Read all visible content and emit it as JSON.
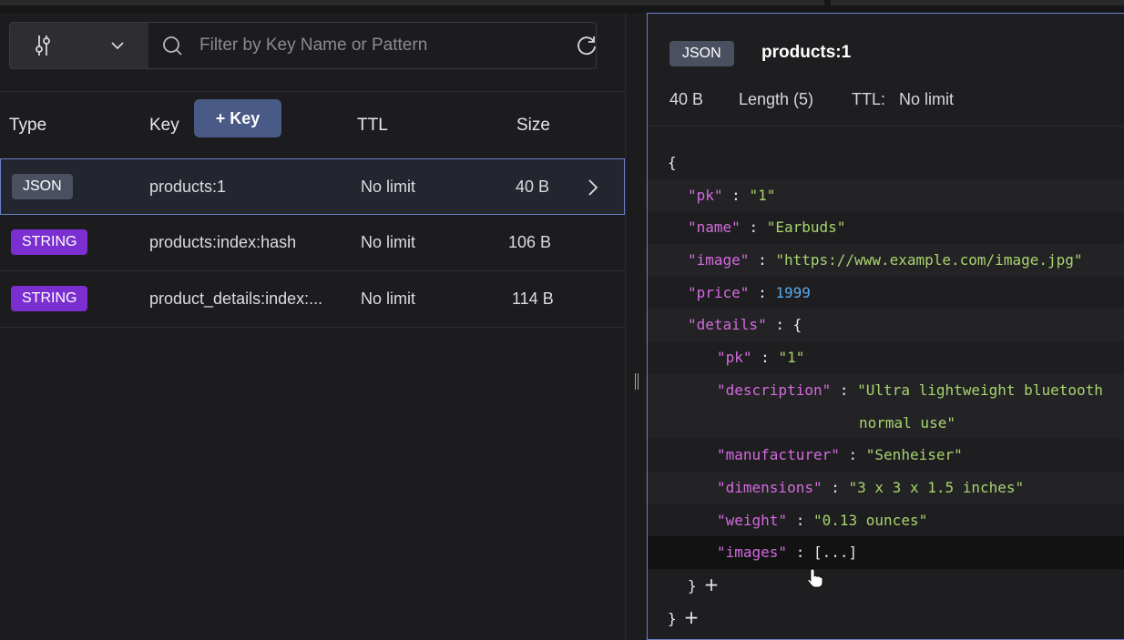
{
  "search": {
    "placeholder": "Filter by Key Name or Pattern"
  },
  "table": {
    "headers": {
      "type": "Type",
      "key": "Key",
      "add_key": "+ Key",
      "ttl": "TTL",
      "size": "Size"
    },
    "rows": [
      {
        "type": "JSON",
        "key": "products:1",
        "ttl": "No limit",
        "size": "40 B"
      },
      {
        "type": "STRING",
        "key": "products:index:hash",
        "ttl": "No limit",
        "size": "106 B"
      },
      {
        "type": "STRING",
        "key": "product_details:index:...",
        "ttl": "No limit",
        "size": "114 B"
      }
    ]
  },
  "detail": {
    "type": "JSON",
    "key": "products:1",
    "size": "40 B",
    "length": "Length (5)",
    "ttl_label": "TTL:",
    "ttl_value": "No limit",
    "json": {
      "open_brace": "{",
      "pk_key": "\"pk\"",
      "pk_val": "\"1\"",
      "name_key": "\"name\"",
      "name_val": "\"Earbuds\"",
      "image_key": "\"image\"",
      "image_val": "\"https://www.example.com/image.jpg\"",
      "price_key": "\"price\"",
      "price_val": "1999",
      "details_key": "\"details\"",
      "d_pk_key": "\"pk\"",
      "d_pk_val": "\"1\"",
      "desc_key": "\"description\"",
      "desc_val_1": "\"Ultra lightweight bluetooth",
      "desc_val_2": "normal use\"",
      "manu_key": "\"manufacturer\"",
      "manu_val": "\"Senheiser\"",
      "dim_key": "\"dimensions\"",
      "dim_val": "\"3 x 3 x 1.5 inches\"",
      "weight_key": "\"weight\"",
      "weight_val": "\"0.13 ounces\"",
      "images_key": "\"images\"",
      "images_val": "[...]",
      "close_inner": "}",
      "close_outer": "}",
      "plus": "+",
      "colon": ":"
    }
  },
  "colors": {
    "accent": "#6a80c8",
    "string_badge": "#7b2fd0",
    "json_badge": "#4a5060",
    "key_color": "#d46ae0",
    "string_color": "#a8d46e",
    "number_color": "#5aa8e8"
  }
}
